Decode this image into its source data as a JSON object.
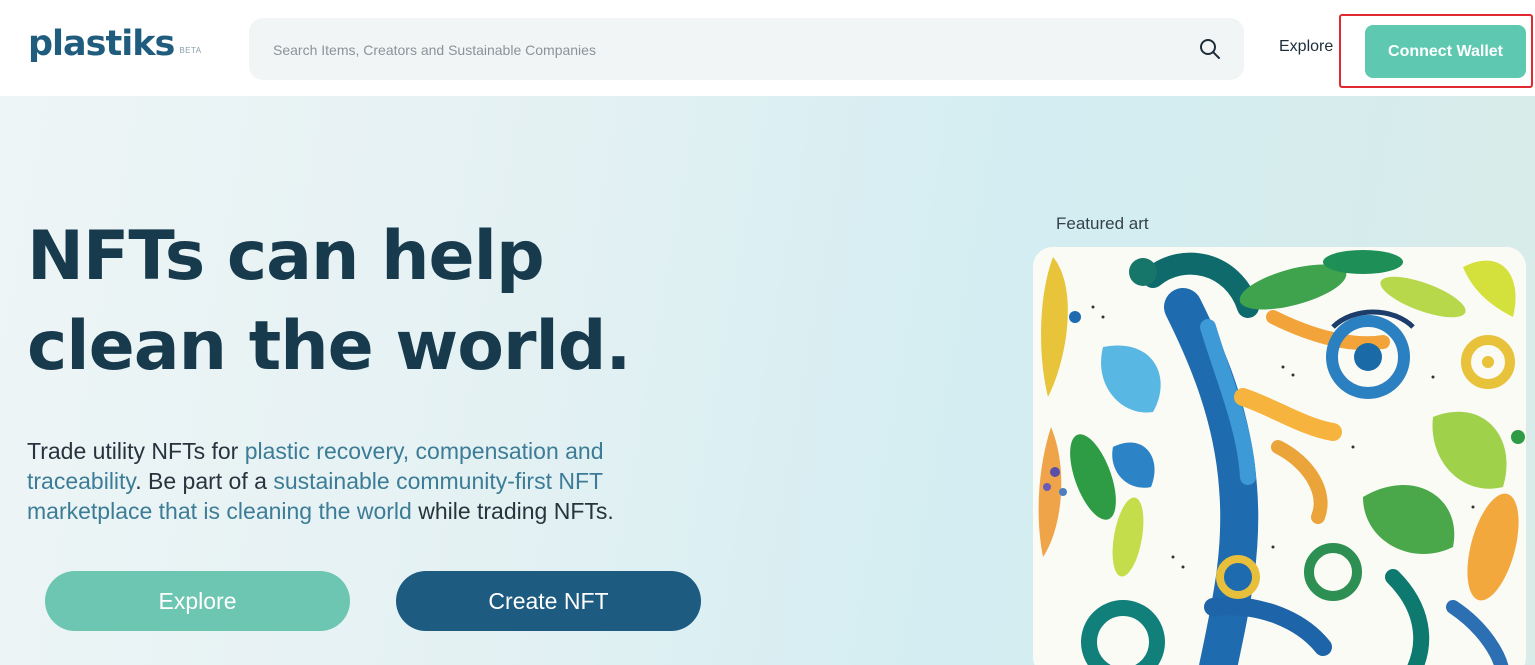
{
  "header": {
    "logo_text": "plastiks",
    "logo_badge": "BETA",
    "search_placeholder": "Search Items, Creators and Sustainable Companies",
    "search_icon": "search-icon",
    "nav_explore": "Explore",
    "connect_wallet": "Connect Wallet"
  },
  "hero": {
    "title_line1": "NFTs can help",
    "title_line2": "clean the world.",
    "text_part1": "Trade utility NFTs for ",
    "text_link1": "plastic recovery, compensation and traceability",
    "text_part2": ". Be part of a ",
    "text_link2": "sustainable community-first NFT marketplace that is cleaning the world",
    "text_part3": " while trading NFTs.",
    "explore_button": "Explore",
    "create_button": "Create NFT"
  },
  "featured": {
    "label": "Featured art"
  },
  "colors": {
    "brand_teal": "#5ec9b0",
    "brand_navy": "#1e5b80",
    "heading": "#183a4d",
    "link": "#3c7c96",
    "highlight_border": "#e2292f"
  }
}
